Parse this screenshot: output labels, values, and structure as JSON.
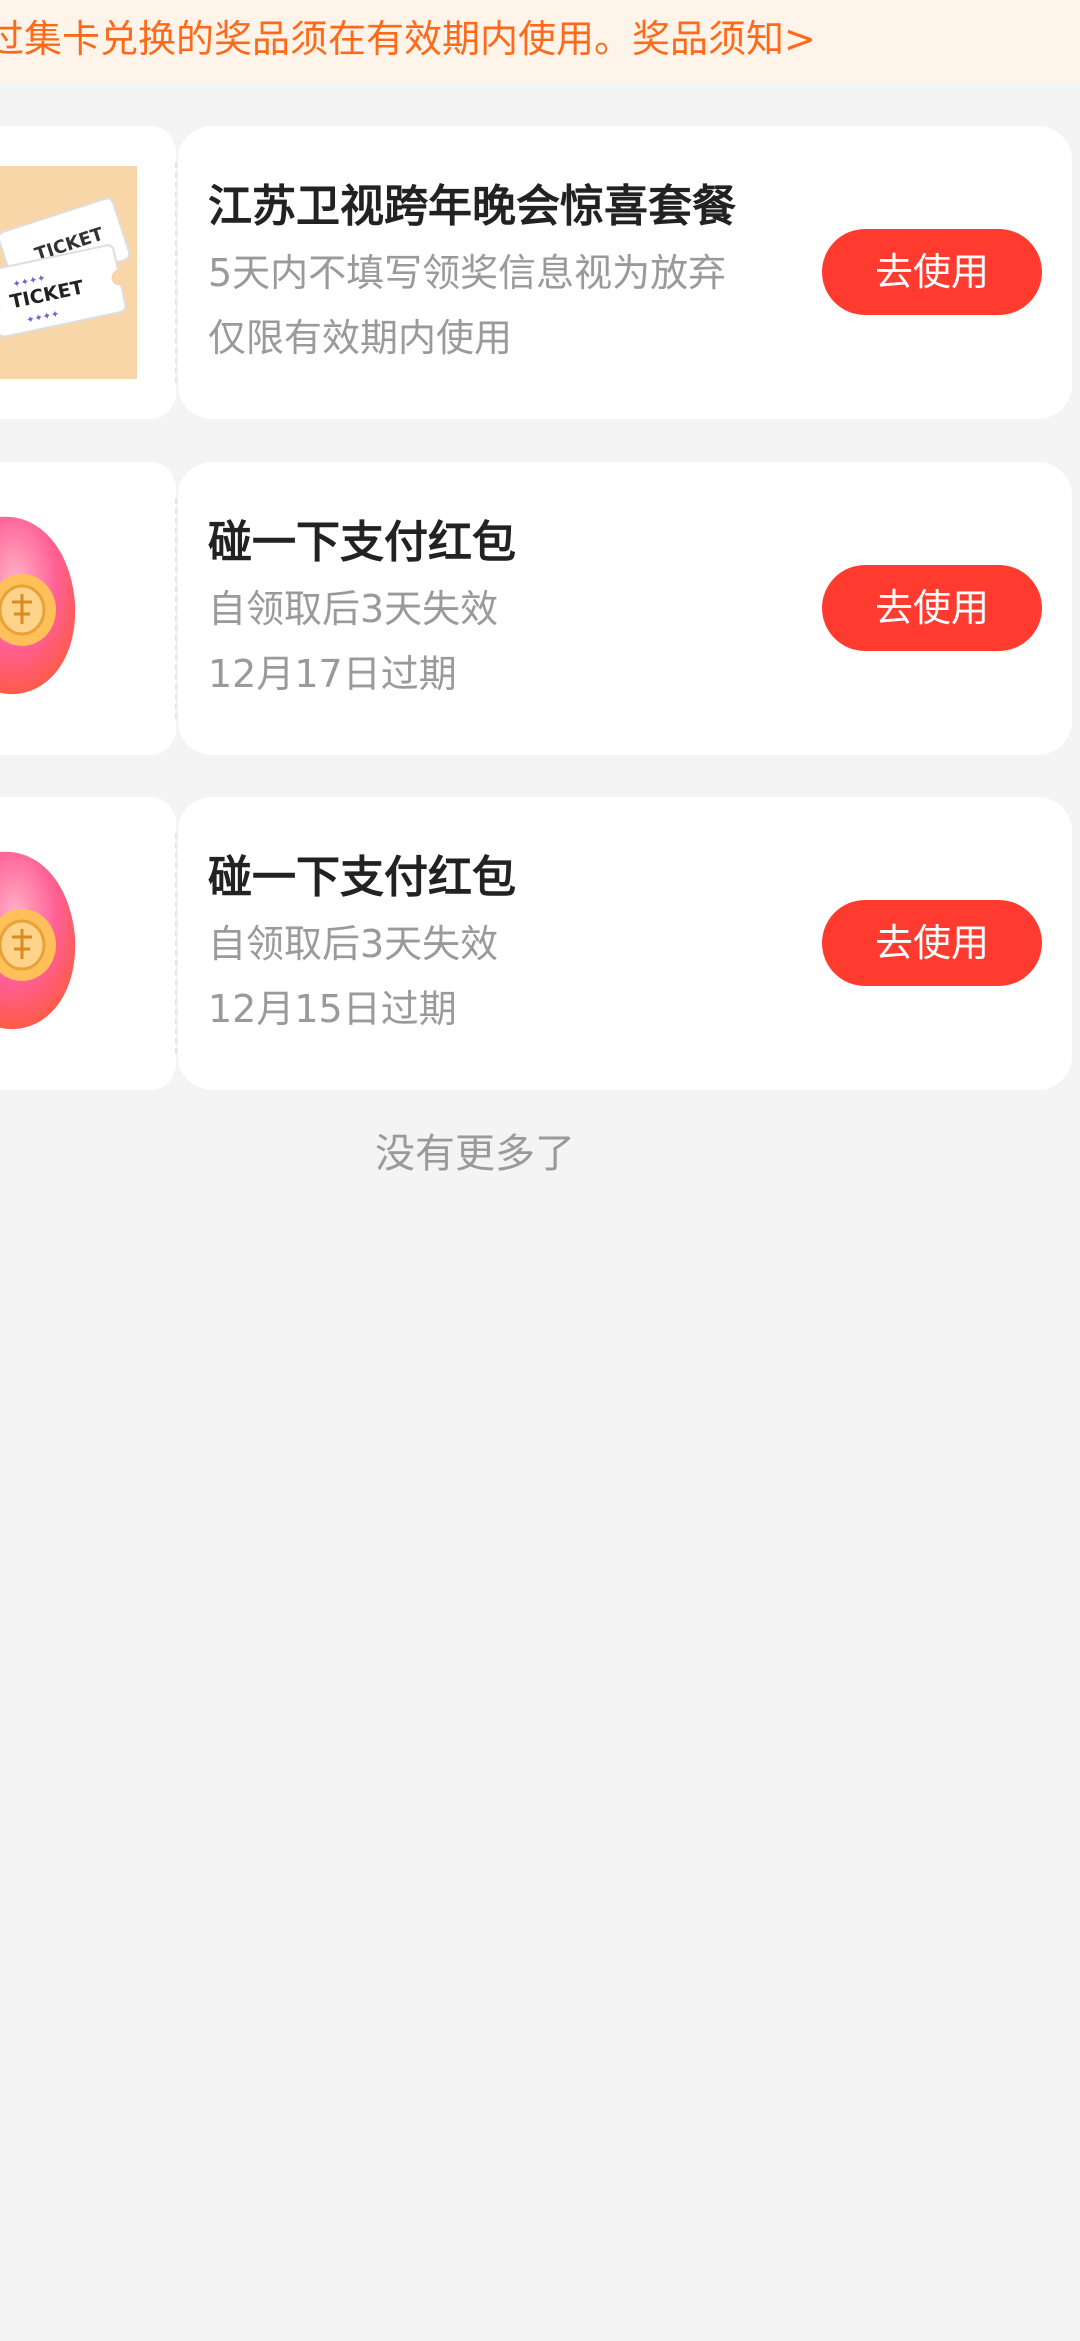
{
  "notice": {
    "text": "过集卡兑换的奖品须在有效期内使用。奖品须知>"
  },
  "prizes": [
    {
      "title": "江苏卫视跨年晚会惊喜套餐",
      "desc1": "5天内不填写领奖信息视为放弃",
      "desc2": "仅限有效期内使用",
      "button_label": "去使用",
      "thumb_icon": "ticket-icon",
      "ticket_text_1": "TICKET",
      "ticket_text_2": "TICKET"
    },
    {
      "title": "碰一下支付红包",
      "desc1": "自领取后3天失效",
      "desc2": "12月17日过期",
      "button_label": "去使用",
      "thumb_icon": "red-packet-bag-icon"
    },
    {
      "title": "碰一下支付红包",
      "desc1": "自领取后3天失效",
      "desc2": "12月15日过期",
      "button_label": "去使用",
      "thumb_icon": "red-packet-bag-icon"
    }
  ],
  "footer": {
    "no_more": "没有更多了"
  },
  "colors": {
    "accent_red": "#ff3b30",
    "notice_orange": "#ff6a1a"
  }
}
